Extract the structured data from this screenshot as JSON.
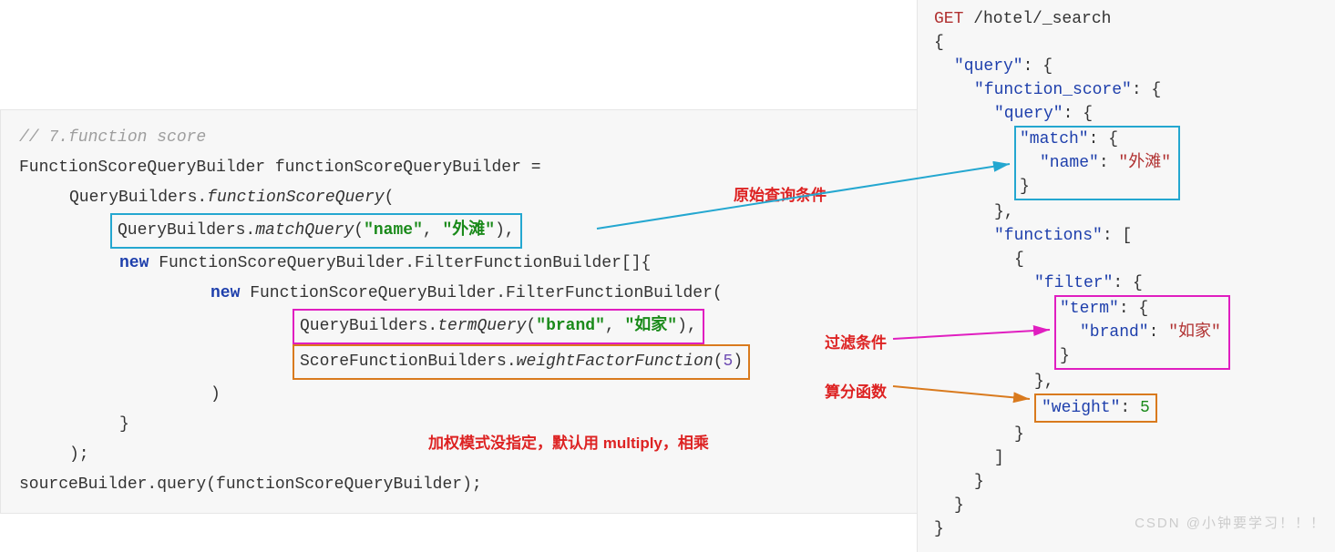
{
  "left": {
    "comment": "// 7.function score",
    "line1a": "FunctionScoreQueryBuilder functionScoreQueryBuilder =",
    "line2a": "QueryBuilders.",
    "line2b": "functionScoreQuery",
    "line2c": "(",
    "match_a": "QueryBuilders.",
    "match_b": "matchQuery",
    "match_c": "(",
    "match_d": "\"name\"",
    "match_e": ", ",
    "match_f": "\"外滩\"",
    "match_g": "),",
    "line4a": "new",
    "line4b": " FunctionScoreQueryBuilder.FilterFunctionBuilder[]{",
    "line5a": "new",
    "line5b": " FunctionScoreQueryBuilder.FilterFunctionBuilder(",
    "term_a": "QueryBuilders.",
    "term_b": "termQuery",
    "term_c": "(",
    "term_d": "\"brand\"",
    "term_e": ", ",
    "term_f": "\"如家\"",
    "term_g": "),",
    "weight_a": "ScoreFunctionBuilders.",
    "weight_b": "weightFactorFunction",
    "weight_c": "(",
    "weight_d": "5",
    "weight_e": ")",
    "close_paren": ")",
    "close_brace": "}",
    "close_end": ");",
    "last": "sourceBuilder.query(functionScoreQueryBuilder);"
  },
  "annotations": {
    "a1": "原始查询条件",
    "a2": "过滤条件",
    "a3": "算分函数",
    "a4": "加权模式没指定，默认用 multiply，相乘"
  },
  "right": {
    "l0a": "GET",
    "l0b": " /hotel/_search",
    "l1": "{",
    "l2a": "\"query\"",
    "l2b": ": {",
    "l3a": "\"function_score\"",
    "l3b": ": {",
    "l4a": "\"query\"",
    "l4b": ": {",
    "l5a": "\"match\"",
    "l5b": ": {",
    "l6a": "\"name\"",
    "l6b": ": ",
    "l6c": "\"外滩\"",
    "l7": "}",
    "l8": "},",
    "l9a": "\"functions\"",
    "l9b": ": [",
    "l10": "{",
    "l11a": "\"filter\"",
    "l11b": ": {",
    "l12a": "\"term\"",
    "l12b": ": {",
    "l13a": "\"brand\"",
    "l13b": ": ",
    "l13c": "\"如家\"",
    "l14": "}",
    "l15": "},",
    "l16a": "\"weight\"",
    "l16b": ": ",
    "l16c": "5",
    "l17": "}",
    "l18": "]",
    "l19": "}",
    "l20": "}",
    "l21": "}"
  },
  "watermark": "CSDN @小钟要学习！！！"
}
